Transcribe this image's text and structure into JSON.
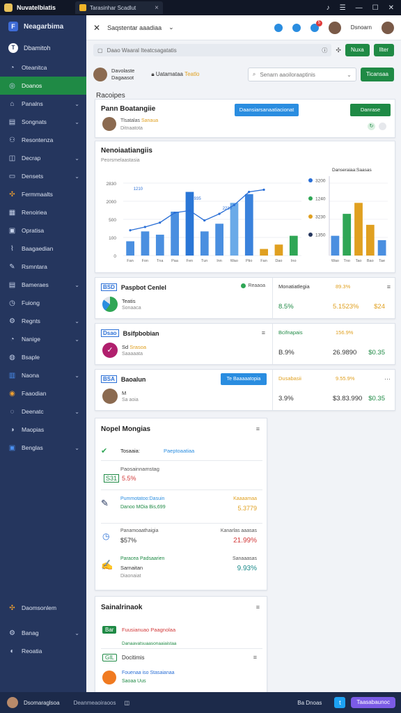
{
  "window": {
    "title": "Nuvatelbiatis",
    "tab_label": "Tarasinhar Scadlut",
    "tab_close": "×",
    "controls": [
      "♪",
      "☰",
      "—",
      "☐",
      "✕"
    ]
  },
  "sidebar": {
    "brand": "Neagarbima",
    "user": "Dbamitoh",
    "items": [
      {
        "label": "Oteanitca",
        "icon": "◔",
        "chev": false,
        "style": ""
      },
      {
        "label": "Doanos",
        "icon": "◎",
        "chev": false,
        "style": "active"
      },
      {
        "label": "Panalns",
        "icon": "⌂",
        "chev": true,
        "style": ""
      },
      {
        "label": "Songnats",
        "icon": "▤",
        "chev": true,
        "style": ""
      },
      {
        "label": "Resontenza",
        "icon": "⚇",
        "chev": false,
        "style": ""
      },
      {
        "label": "Decrap",
        "icon": "◫",
        "chev": true,
        "style": ""
      },
      {
        "label": "Densets",
        "icon": "▭",
        "chev": true,
        "style": ""
      },
      {
        "label": "Fermmaalts",
        "icon": "✣",
        "chev": false,
        "style": "orange"
      },
      {
        "label": "Renoiriea",
        "icon": "▦",
        "chev": false,
        "style": ""
      },
      {
        "label": "Opratisa",
        "icon": "▣",
        "chev": false,
        "style": ""
      },
      {
        "label": "Baagaedian",
        "icon": "⌇",
        "chev": false,
        "style": ""
      },
      {
        "label": "Rsmntara",
        "icon": "✎",
        "chev": false,
        "style": ""
      },
      {
        "label": "Bameraes",
        "icon": "▤",
        "chev": true,
        "style": ""
      },
      {
        "label": "Fuiong",
        "icon": "◷",
        "chev": false,
        "style": ""
      },
      {
        "label": "Regnts",
        "icon": "⚙",
        "chev": true,
        "style": ""
      },
      {
        "label": "Nanige",
        "icon": "◔",
        "chev": true,
        "style": ""
      },
      {
        "label": "Bsaple",
        "icon": "◍",
        "chev": false,
        "style": ""
      },
      {
        "label": "Naona",
        "icon": "▥",
        "chev": true,
        "style": "blue"
      },
      {
        "label": "Faaodian",
        "icon": "◉",
        "chev": false,
        "style": "orange"
      },
      {
        "label": "Deenatc",
        "icon": "◌",
        "chev": true,
        "style": ""
      },
      {
        "label": "Maopias",
        "icon": "◑",
        "chev": false,
        "style": ""
      },
      {
        "label": "Benglas",
        "icon": "▣",
        "chev": true,
        "style": "blue"
      },
      {
        "label": "Daomsonlem",
        "icon": "✣",
        "chev": false,
        "style": "orange"
      },
      {
        "label": "Banag",
        "icon": "⚙",
        "chev": true,
        "style": ""
      },
      {
        "label": "Reoatia",
        "icon": "◐",
        "chev": false,
        "style": ""
      }
    ]
  },
  "topbar": {
    "title": "Saqstentar aaadiaa",
    "user": "Dsnoarn",
    "badge": "5"
  },
  "toolbar": {
    "address": "Daao Waaral Iteatcsagatatis",
    "btn1": "Nuxa",
    "btn2": "Ilter"
  },
  "row3": {
    "name1": "Davolaste",
    "name2": "Dagaasot",
    "tag_pre": "Uatamataa",
    "tag_hl": "Teatlo",
    "search_placeholder": "Senarn aaoiloraaptinis",
    "btn": "Ticansaa"
  },
  "section_title": "Racoipes",
  "profile": {
    "name": "Pann Boatangiie",
    "line1_pre": "Tlsatalas",
    "line1_hl": "Sanaua",
    "line2": "Ditnaatota",
    "btn_blue": "Daansiarsanaatiacionat",
    "btn_green": "Danrase"
  },
  "chart": {
    "title": "Nenoiaatiangiis",
    "subtitle": "Peorsmelaastasia",
    "legend_title": "Danseraiaa:Saasas"
  },
  "chart_data": [
    {
      "type": "bar",
      "categories": [
        "Fan",
        "Fon",
        "Tna",
        "Paa",
        "Fen",
        "Tun",
        "Inn",
        "Wao",
        "Ptio",
        "Fan",
        "Dao",
        "Ino"
      ],
      "series": [
        {
          "name": "Bars",
          "values": [
            650,
            1100,
            950,
            2000,
            2900,
            1100,
            1450,
            2400,
            2800,
            300,
            500,
            900
          ]
        }
      ],
      "line": [
        1150,
        1300,
        1500,
        1950,
        2050,
        1600,
        1900,
        2300,
        2900,
        3000
      ],
      "yticks": [
        "2830",
        "2000",
        "500",
        "100",
        "0"
      ],
      "annotations": [
        "1210",
        "935",
        "2210"
      ],
      "ylim": [
        0,
        3300
      ]
    },
    {
      "type": "bar",
      "categories": [
        "Wao",
        "Tno",
        "Tao",
        "Bao",
        "Tae"
      ],
      "series": [
        {
          "name": "Bars",
          "values": [
            900,
            1900,
            2400,
            1400,
            700
          ]
        }
      ],
      "legend": [
        "3200",
        "1240",
        "3230",
        "1350"
      ],
      "yticks": [
        "3320",
        "2238",
        "1233",
        "1350",
        "0"
      ],
      "ylim": [
        0,
        3300
      ]
    }
  ],
  "metrics": [
    {
      "code": "BSD",
      "title": "Paspbot Cenlel",
      "status": "Reaaoa",
      "line1": "Teatis",
      "line2": "Sonaaca",
      "right_head": "Monatiatlegia",
      "right_pct": "89.3%",
      "v1": "8.5%",
      "v2": "5.1523%",
      "v3": "$24",
      "icon_color": "#2fa655",
      "menu": "≡"
    },
    {
      "code": "Dsao",
      "title": "Bsifpbobian",
      "line1_pre": "Sd",
      "line1_hl": "Srasoa",
      "line2": "Saaaaata",
      "right_head": "Bcifnapais",
      "right_pct": "156.9%",
      "v1": "B.9%",
      "v2": "26.9890",
      "v3": "$0.35",
      "icon_color": "#b01f6d",
      "menu": "≡"
    },
    {
      "code": "BSA",
      "title": "Baoalun",
      "line1": "M",
      "line2": "Sa aoia",
      "btn": "Te  Baaaaatopia",
      "right_head": "Dusabasii",
      "right_pct": "9.55.9%",
      "v1": "3.9%",
      "v2": "$3.83.990",
      "v3": "$0.35",
      "icon_color": "#8b6a50",
      "menu": "⋯"
    }
  ],
  "list": {
    "title": "Nopel Mongias",
    "menu": "≡",
    "rows": [
      {
        "a": "Tosaaia:",
        "b": "Paeptoaatiaa",
        "icon": "check-icon"
      },
      {
        "a": "Paosainnamstag",
        "b": "5.5%",
        "code": "S31",
        "icon": "code-icon"
      },
      {
        "a": "Pummotatoo:Dasuin",
        "b": "Danoo MOia Bis,699",
        "right_top": "Kaaaamaa",
        "right": "5.3779",
        "icon": "pen-icon"
      },
      {
        "a": "Panamoaathaigia",
        "b": "$57%",
        "right_top": "Kanarlas aaasas",
        "right": "21.99%",
        "icon": "timer-icon"
      },
      {
        "a": "Paracea Padsaarien",
        "b": "Sarnaitan",
        "c": "Diaonaiat",
        "right_top": "Sanaaasas",
        "right": "9.93%",
        "icon": "edit-icon"
      }
    ]
  },
  "notif": {
    "title": "Sainalrinaok",
    "menu": "≡",
    "r1_code": "Bar",
    "r1_text": "Fuusianuao Paagnolaa",
    "r1_sub": "Danaavatsuaasonaaiaistaa",
    "r2_code": "GIL",
    "r2_text": "Docitimis",
    "r3_a": "Fouenaa iso Stasaianaa",
    "r3_b": "Saoaa Uus"
  },
  "statusbar": {
    "user": "Dsomaraglsoa",
    "text": "Deanmeaoiraoos",
    "right": "Ba  Dnoas",
    "cta": "Taasabaunoc"
  }
}
